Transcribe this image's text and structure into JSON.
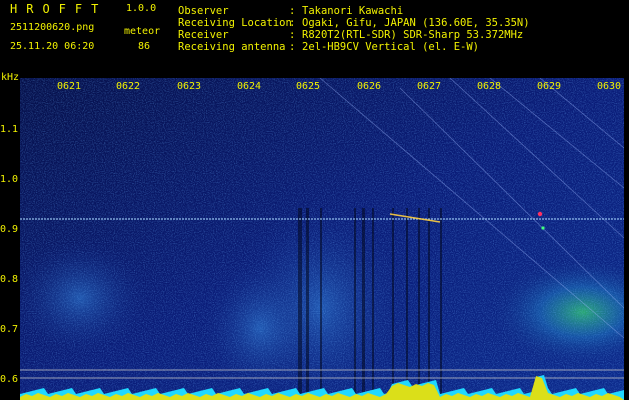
{
  "header": {
    "app_name": "HROFFT",
    "version": "1.0.0",
    "filename": "2511200620.png",
    "datetime": "25.11.20 06:20",
    "mode": "meteor",
    "count": "86"
  },
  "info": [
    {
      "label": "Observer",
      "value": "Takanori Kawachi"
    },
    {
      "label": "Receiving Location",
      "value": "Ogaki, Gifu, JAPAN (136.60E, 35.35N)"
    },
    {
      "label": "Receiver",
      "value": "R820T2(RTL-SDR) SDR-Sharp 53.372MHz"
    },
    {
      "label": "Receiving antenna",
      "value": "2el-HB9CV Vertical (el. E-W)"
    }
  ],
  "separator": ":",
  "axis": {
    "unit": "kHz",
    "time_labels": [
      "0621",
      "0622",
      "0623",
      "0624",
      "0625",
      "0626",
      "0627",
      "0628",
      "0629",
      "0630"
    ],
    "freq_labels": [
      "1.1",
      "1.0",
      "0.9",
      "0.8",
      "0.7",
      "0.6"
    ]
  },
  "colors": {
    "text": "#f2f200",
    "background": "#000000",
    "spectrum_low": "#0a1a6e",
    "spectrum_high": "#40e060",
    "baseline": "#20d8ff"
  }
}
